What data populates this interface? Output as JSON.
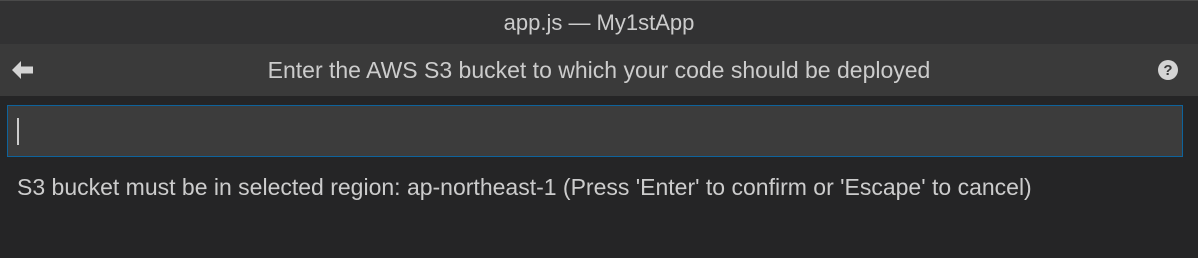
{
  "window": {
    "title": "app.js — My1stApp"
  },
  "quick_input": {
    "title": "Enter the AWS S3 bucket to which your code should be deployed",
    "back_icon": "arrow-left-icon",
    "help_icon": "question-circle-icon",
    "help_glyph": "?",
    "input_value": "",
    "input_placeholder": "",
    "message": "S3 bucket must be in selected region: ap-northeast-1 (Press 'Enter' to confirm or 'Escape' to cancel)"
  },
  "colors": {
    "focus_border": "#0e639c",
    "header_bg": "#3a3a3a",
    "panel_bg": "#252526"
  }
}
